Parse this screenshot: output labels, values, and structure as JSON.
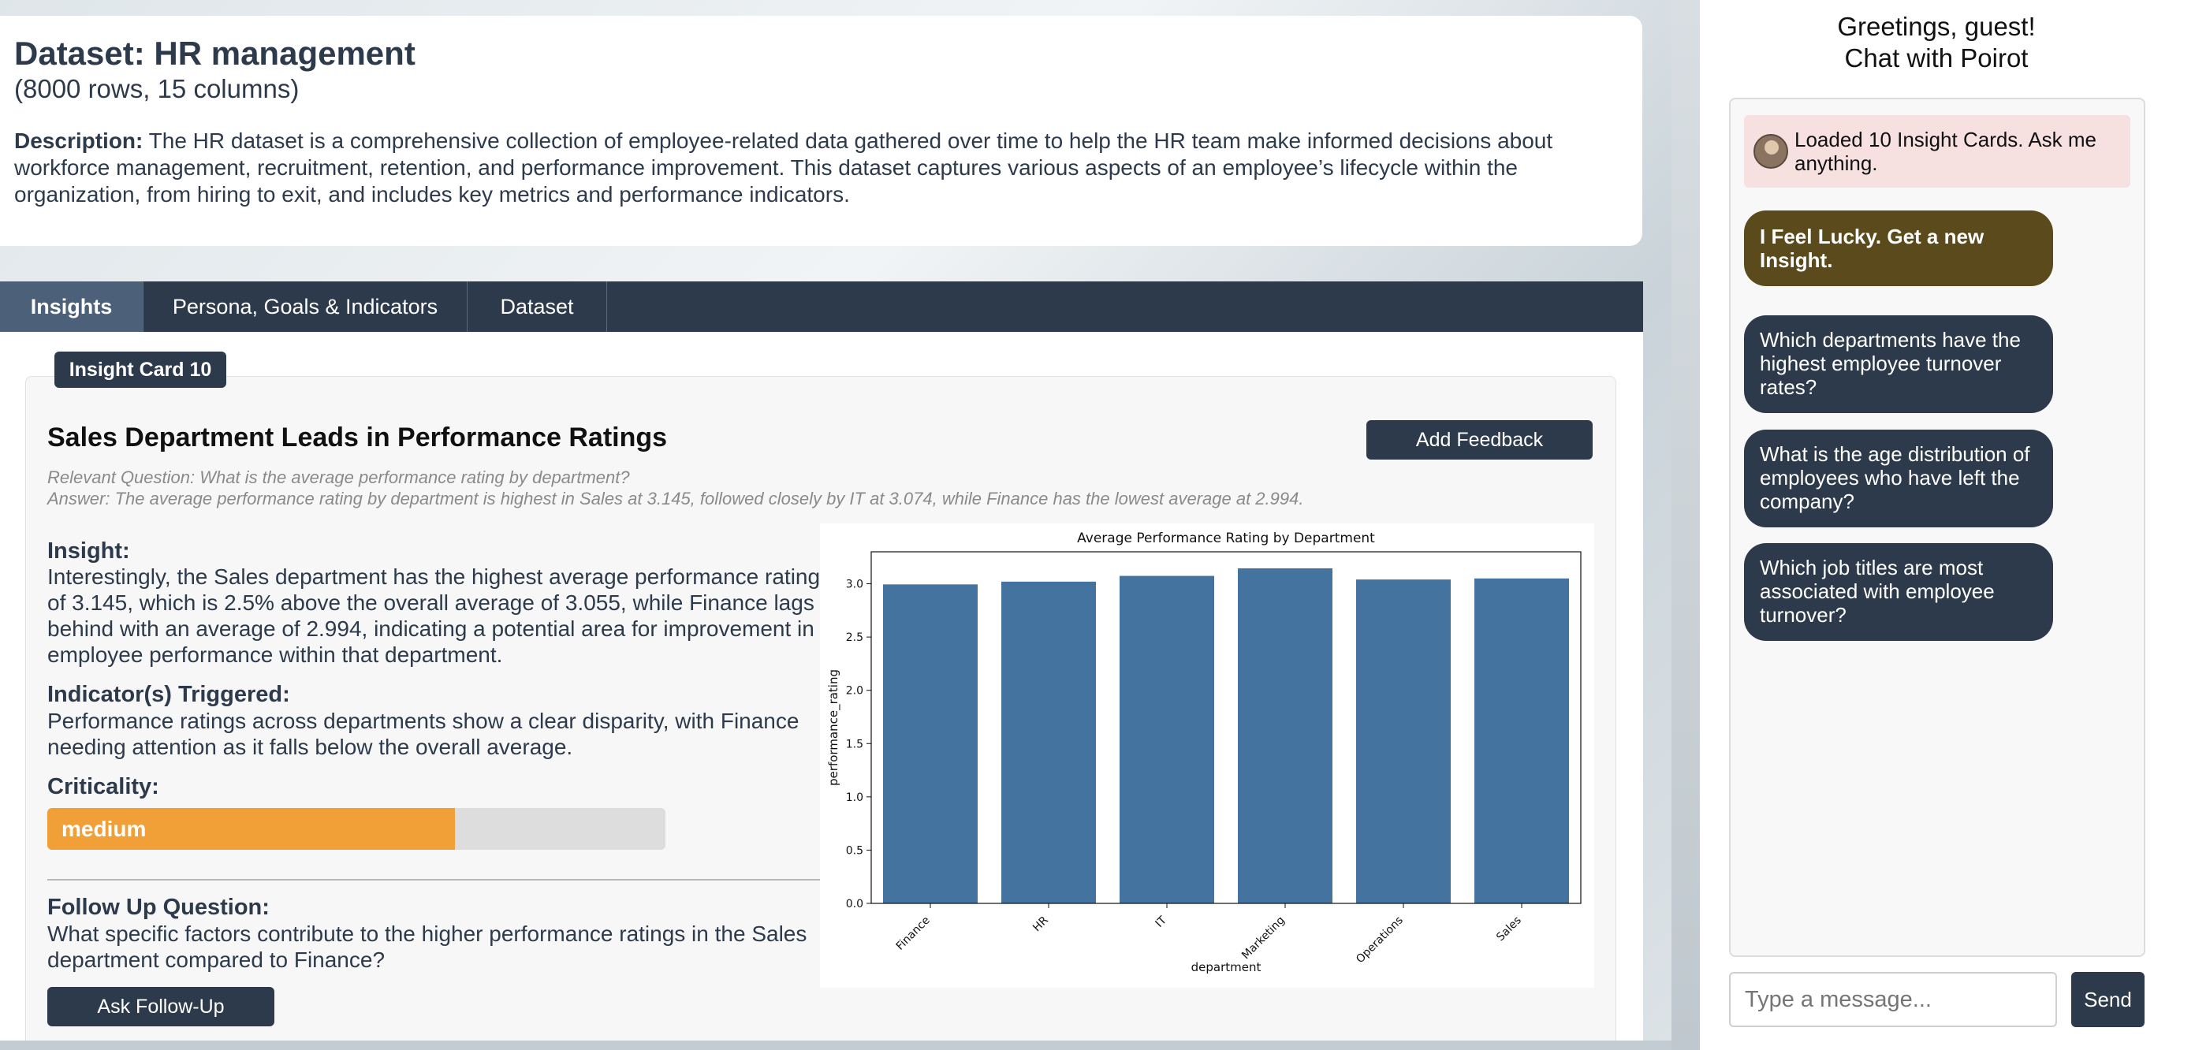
{
  "dataset": {
    "title": "Dataset: HR management",
    "subtitle": "(8000 rows, 15 columns)",
    "description_label": "Description:",
    "description": "The HR dataset is a comprehensive collection of employee-related data gathered over time to help the HR team make informed decisions about workforce management, recruitment, retention, and performance improvement. This dataset captures various aspects of an employee’s lifecycle within the organization, from hiring to exit, and includes key metrics and performance indicators."
  },
  "tabs": [
    {
      "label": "Insights",
      "active": true
    },
    {
      "label": "Persona, Goals & Indicators",
      "active": false
    },
    {
      "label": "Dataset",
      "active": false
    }
  ],
  "card": {
    "badge": "Insight Card 10",
    "title": "Sales Department Leads in Performance Ratings",
    "feedback_label": "Add Feedback",
    "relevant_question": "Relevant Question: What is the average performance rating by department?",
    "answer": "Answer: The average performance rating by department is highest in Sales at 3.145, followed closely by IT at 3.074, while Finance has the lowest average at 2.994.",
    "insight_heading": "Insight:",
    "insight_text": "Interestingly, the Sales department has the highest average performance rating of 3.145, which is 2.5% above the overall average of 3.055, while Finance lags behind with an average of 2.994, indicating a potential area for improvement in employee performance within that department.",
    "indicator_heading": "Indicator(s) Triggered:",
    "indicator_text": "Performance ratings across departments show a clear disparity, with Finance needing attention as it falls below the overall average.",
    "criticality_heading": "Criticality:",
    "criticality_label": "medium",
    "criticality_level": 0.66,
    "criticality_color": "#f19f37",
    "followup_heading": "Follow Up Question:",
    "followup_text": "What specific factors contribute to the higher performance ratings in the Sales department compared to Finance?",
    "ask_label": "Ask Follow-Up"
  },
  "chart_data": {
    "type": "bar",
    "title": "Average Performance Rating by Department",
    "xlabel": "department",
    "ylabel": "performance_rating",
    "categories": [
      "Finance",
      "HR",
      "IT",
      "Marketing",
      "Operations",
      "Sales"
    ],
    "values": [
      2.994,
      3.02,
      3.074,
      3.145,
      3.04,
      3.05
    ],
    "ylim": [
      0,
      3.3
    ],
    "yticks": [
      "0.0",
      "0.5",
      "1.0",
      "1.5",
      "2.0",
      "2.5",
      "3.0"
    ],
    "bar_color": "#4473a0",
    "grid": false
  },
  "chat": {
    "greeting_line1": "Greetings, guest!",
    "greeting_line2": "Chat with Poirot",
    "system_message": "Loaded 10 Insight Cards. Ask me anything.",
    "lucky_label": "I Feel Lucky. Get a new Insight.",
    "suggestions": [
      "Which departments have the highest employee turnover rates?",
      "What is the age distribution of employees who have left the company?",
      "Which job titles are most associated with employee turnover?"
    ],
    "input_placeholder": "Type a message...",
    "send_label": "Send"
  },
  "colors": {
    "navy": "#2d3a4b",
    "lucky": "#5b4a1b",
    "system_bg": "#f6e0e0"
  }
}
